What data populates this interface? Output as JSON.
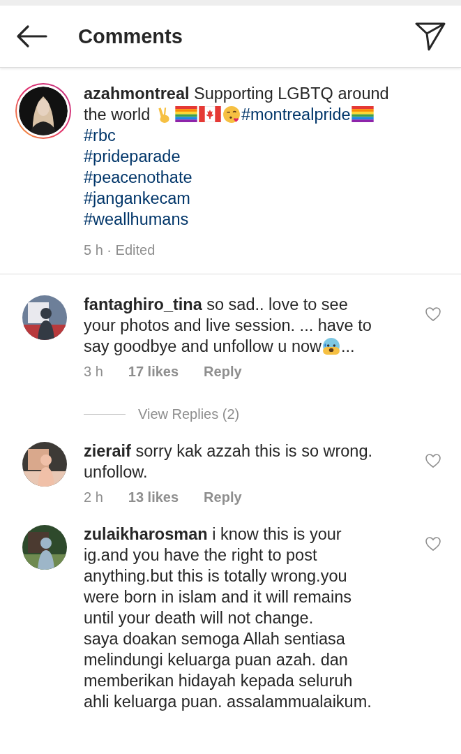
{
  "header": {
    "title": "Comments"
  },
  "post": {
    "username": "azahmontreal",
    "text": "Supporting LGBTQ around the world",
    "hashtags": [
      "#montrealpride",
      "#rbc",
      "#prideparade",
      "#peacenothate",
      "#jangankecam",
      "#weallhumans"
    ],
    "time": "5 h · Edited"
  },
  "comments": [
    {
      "username": "fantaghiro_tina",
      "text": "so sad.. love to see your photos and live session. ... have to say goodbye and unfollow u now",
      "text_after_emoji": "...",
      "time": "3 h",
      "likes": "17 likes",
      "reply": "Reply",
      "liked": false,
      "view_replies": "View Replies (2)"
    },
    {
      "username": "zieraif",
      "text": "sorry kak azzah this is so wrong. unfollow.",
      "time": "2 h",
      "likes": "13 likes",
      "reply": "Reply",
      "liked": false
    },
    {
      "username": "zulaikharosman",
      "text": "i know this is your ig.and you have the right to post anything.but this is totally wrong.you were born in islam and it will remains until your death will not change.\nsaya doakan semoga Allah sentiasa melindungi keluarga puan azah. dan memberikan hidayah kepada seluruh ahli keluarga puan. assalammualaikum.",
      "liked": false
    }
  ]
}
